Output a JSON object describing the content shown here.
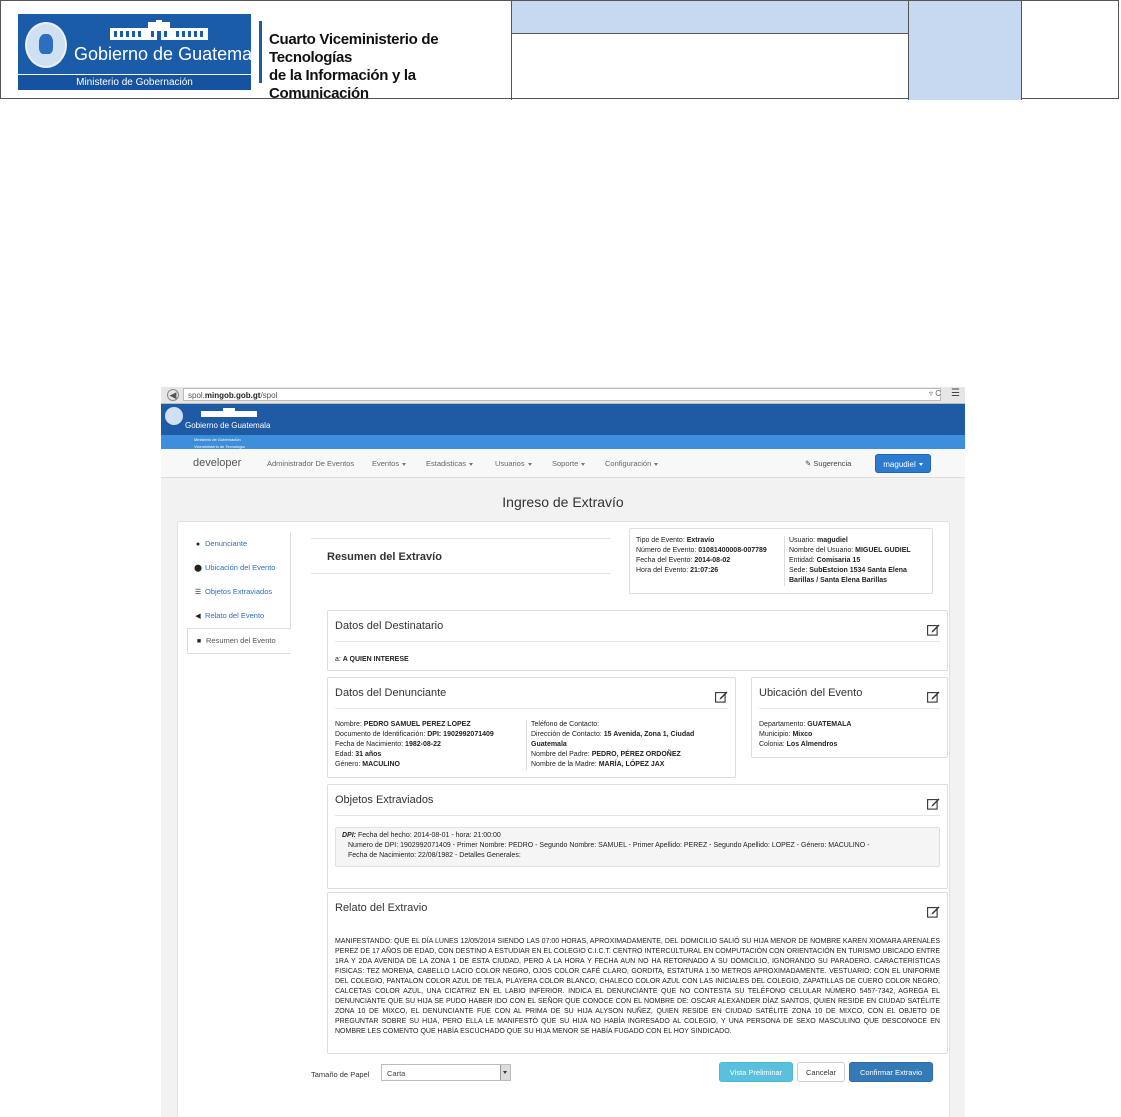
{
  "header": {
    "logo_name": "Gobierno de Guatemala",
    "logo_ministry": "Ministerio de Gobernación",
    "vice_line1": "Cuarto Viceministerio de Tecnologías",
    "vice_line2": "de la Información y la Comunicación",
    "accent_color": "#1a5ca8",
    "cell_color": "#c6d9f1"
  },
  "browser": {
    "url_prefix": "spol.",
    "url_domain": "mingob.gob.gt",
    "url_path": "/spol"
  },
  "app_banner": {
    "logo_name": "Gobierno de Guatemala",
    "sub1": "Ministerio de Gobernación",
    "sub2": "Viceministerio de Tecnología"
  },
  "navbar": {
    "brand": "developer",
    "items": [
      "Administrador De Eventos",
      "Eventos",
      "Estadisticas",
      "Usuarios",
      "Soporte",
      "Configuración"
    ],
    "suggestion": "Sugerencia",
    "user": "magudiel"
  },
  "page_title": "Ingreso de Extravío",
  "sidebar": {
    "items": [
      {
        "label": "Denunciante",
        "icon": "user-icon"
      },
      {
        "label": "Ubicación del Evento",
        "icon": "map-marker-icon"
      },
      {
        "label": "Objetos Extraviados",
        "icon": "list-icon"
      },
      {
        "label": "Relato del Evento",
        "icon": "bullhorn-icon"
      },
      {
        "label": "Resumen del Evento",
        "icon": "print-icon"
      }
    ]
  },
  "summary": {
    "title": "Resumen del Extravío",
    "tipo_label": "Tipo de Evento:",
    "tipo": "Extravío",
    "numero_label": "Número de Evento:",
    "numero": "01081400008-007789",
    "fecha_label": "Fecha del Evento:",
    "fecha": "2014-08-02",
    "hora_label": "Hora del Evento:",
    "hora": "21:07:26",
    "usuario_label": "Usuario:",
    "usuario": "magudiel",
    "nombre_label": "Nombre del Usuario:",
    "nombre": "MIGUEL GUDIEL",
    "entidad_label": "Entidad:",
    "entidad": "Comisaria 15",
    "sede_label": "Sede:",
    "sede": "SubEstcion 1534 Santa Elena Barillas / Santa Elena Barillas"
  },
  "destinatario": {
    "title": "Datos del Destinatario",
    "a_label": "a:",
    "a_value": "A QUIEN INTERESE"
  },
  "denunciante": {
    "title": "Datos del Denunciante",
    "nombre_label": "Nombre:",
    "nombre": "PEDRO SAMUEL PEREZ LOPEZ",
    "doc_label": "Documento de Identificación:",
    "doc": "DPI: 1902992071409",
    "nac_label": "Fecha de Nacimiento:",
    "nac": "1982-08-22",
    "edad_label": "Edad:",
    "edad": "31 años",
    "genero_label": "Género:",
    "genero": "MACULINO",
    "tel_label": "Teléfono de Contacto:",
    "tel": "",
    "dir_label": "Dirección de Contacto:",
    "dir": "15 Avenida, Zona 1, Ciudad Guatemala",
    "padre_label": "Nombre del Padre:",
    "padre": "PEDRO, PÉREZ ORDOÑEZ",
    "madre_label": "Nombre de la Madre:",
    "madre": "MARÍA, LÓPEZ JAX"
  },
  "ubicacion": {
    "title": "Ubicación del Evento",
    "depto_label": "Departamento:",
    "depto": "GUATEMALA",
    "muni_label": "Municipio:",
    "muni": "Mixco",
    "colonia_label": "Colonia:",
    "colonia": "Los Almendros"
  },
  "objetos": {
    "title": "Objetos Extraviados",
    "line1_label": "DPI:",
    "line1": "Fecha del hecho: 2014-08-01 - hora: 21:00:00",
    "line2": "Numero de DPI: 1902992071409 - Primer Nombre: PEDRO - Segundo Nombre: SAMUEL - Primer Apellido: PEREZ - Segundo Apellido: LOPEZ - Género: MACULINO -",
    "line3": "Fecha de Nacimiento: 22/08/1982 - Detalles Generales:"
  },
  "relato": {
    "title": "Relato del Extravio",
    "text": "MANIFESTANDO: QUE EL DÍA LUNES 12/05/2014 SIENDO LAS 07:00 HORAS, APROXIMADAMENTE, DEL DOMICILIO SALIÓ SU HIJA MENOR DE NOMBRE KAREN XIOMARA ARENALES PEREZ DE 17 AÑOS DE EDAD, CON DESTINO A ESTUDIAR EN EL COLEGIO C.I.C.T. CENTRO INTERCULTURAL EN COMPUTACIÓN CON ORIENTACIÓN EN TURISMO UBICADO ENTRE 1RA Y 2DA AVENIDA DE LA ZONA 1 DE ESTA CIUDAD, PERO A LA HORA Y FECHA AUN NO HA RETORNADO A SU DOMICILIO, IGNORANDO SU PARADERO. CARACTERISTICAS FISICAS: TEZ MORENA, CABELLO LACIO COLOR NEGRO, OJOS COLOR CAFÉ CLARO, GORDITA, ESTATURA 1.50 METROS APROXIMADAMENTE. VESTUARIO: CON EL UNIFORME DEL COLEGIO, PANTALON COLOR AZUL DE TELA, PLAYERA COLOR BLANCO, CHALECO COLOR AZUL CON LAS INICIALES DEL COLEGIO, ZAPATILLAS DE CUERO COLOR NEGRO, CALCETAS COLOR AZUL, UNA CICATRIZ EN EL LABIO INFERIOR. INDICA EL DENUNCIANTE QUE NO CONTESTA SU TELÉFONO CELULAR NÚMERO 5457-7342, AGREGA EL DENUNCIANTE QUE SU HIJA SE PUDO HABER IDO CON EL SEÑOR QUE CONOCE CON EL NOMBRE DE: OSCAR ALEXANDER DÍAZ SANTOS, QUIEN RESIDE EN CIUDAD SATÉLITE ZONA 10 DE MIXCO, EL DENUNCIANTE FUE CON AL PRIMA DE SU HIJA ALYSON NUÑEZ, QUIEN RESIDE EN CIUDAD SATÉLITE ZONA 10 DE MIXCO, CON EL OBJETO DE PREGUNTAR SOBRE SU HIJA, PERO ELLA LE MANIFESTÓ QUE SU HIJA NO HABÍA INGRESADO AL COLEGIO, Y UNA PERSONA DE SEXO MASCULINO QUE DESCONOCE EN NOMBRE LES COMENTO QUE HABÍA ESCUCHADO QUE SU HIJA MENOR SE HABÍA FUGADO CON EL HOY SINDICADO."
  },
  "footer": {
    "paper_label": "Tamaño de Papel",
    "paper_value": "Carta",
    "preview": "Vista Preliminar",
    "cancel": "Cancelar",
    "confirm": "Confirmar Extravio"
  }
}
